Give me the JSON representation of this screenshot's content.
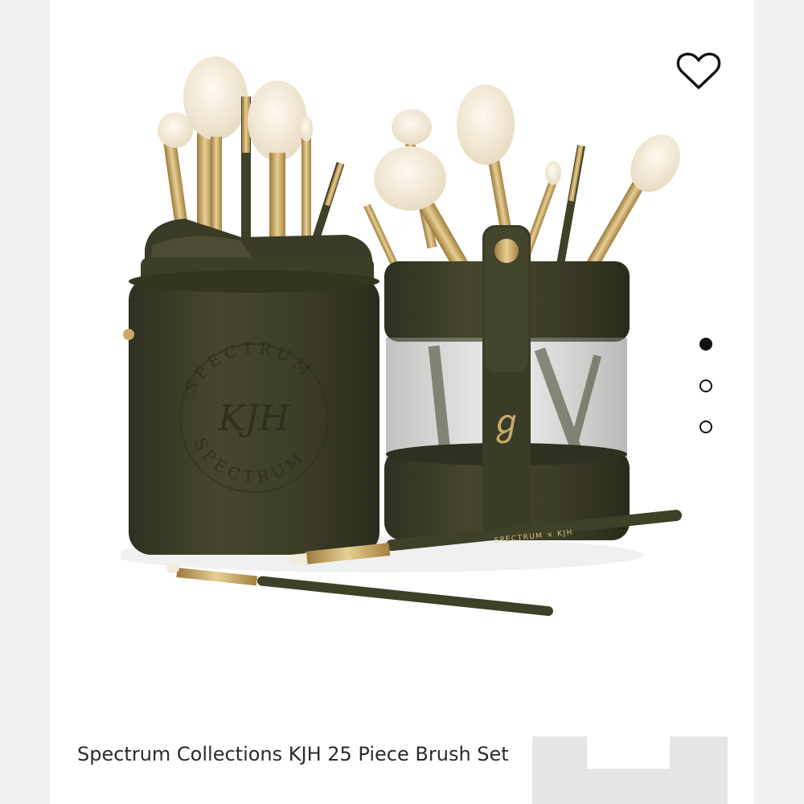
{
  "product": {
    "title": "Spectrum Collections KJH 25 Piece Brush Set",
    "image_alt": "Product photo: green leather brush cylinder cases with gold makeup brushes",
    "case_emboss": {
      "ring_text": "SPECTRUM",
      "monogram": "KJH"
    },
    "brush_text": "SPECTRUM × KJH"
  },
  "favorite": {
    "icon": "heart-icon"
  },
  "carousel": {
    "total": 3,
    "active_index": 0
  },
  "colors": {
    "case_green": "#3f4028",
    "brush_gold": "#c9a96a",
    "bristle_cream": "#f3ebdc",
    "dot_active": "#111111"
  }
}
